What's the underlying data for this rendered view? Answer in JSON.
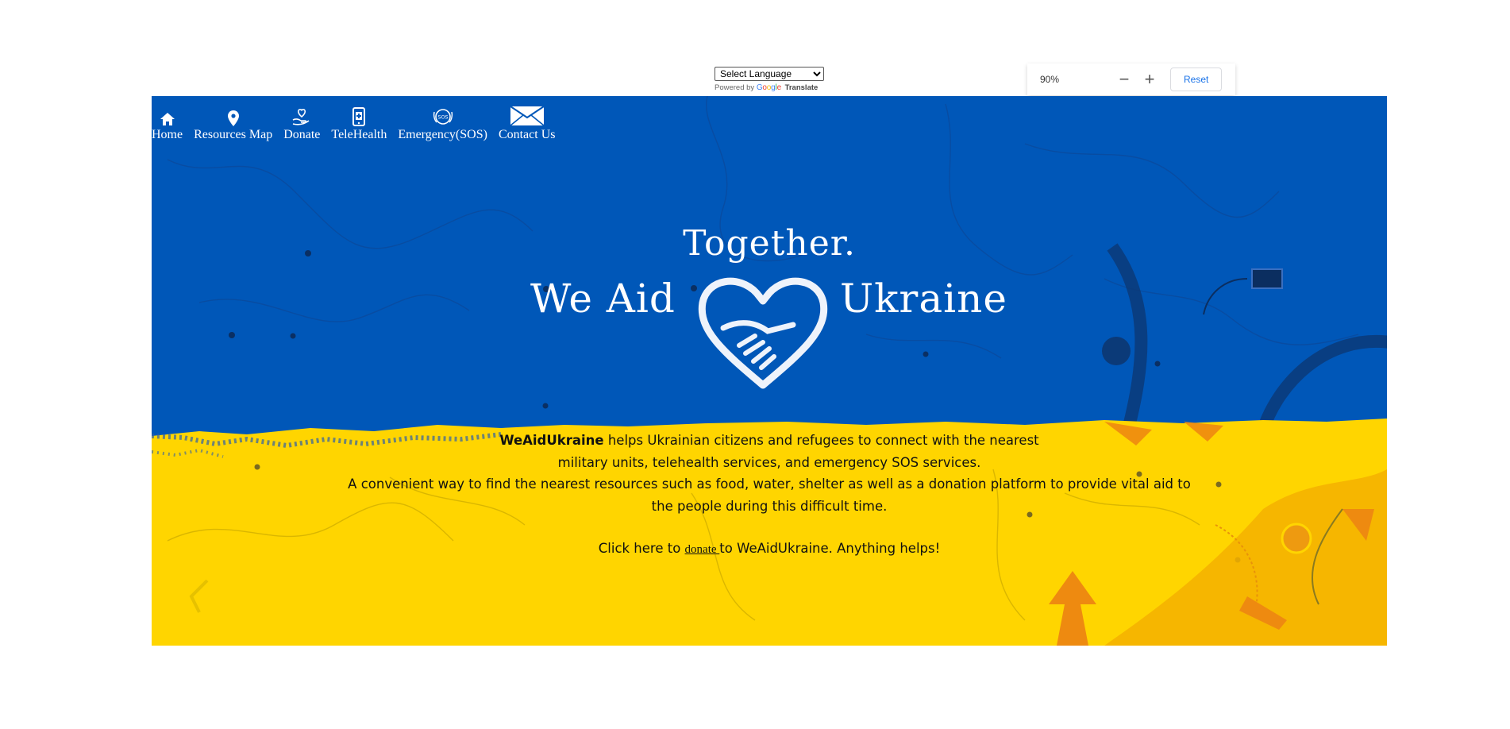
{
  "translate": {
    "select_value": "Select Language",
    "powered_by": "Powered by",
    "google_logo": [
      "G",
      "o",
      "o",
      "g",
      "l",
      "e"
    ],
    "translate_label": "Translate"
  },
  "zoom": {
    "level": "90%",
    "minus": "−",
    "plus": "+",
    "reset": "Reset"
  },
  "nav": {
    "items": [
      {
        "label": "Home",
        "icon": "home-icon"
      },
      {
        "label": "Resources Map",
        "icon": "map-pin-icon"
      },
      {
        "label": "Donate",
        "icon": "donate-heart-hand-icon"
      },
      {
        "label": "TeleHealth",
        "icon": "phone-medical-icon"
      },
      {
        "label": "Emergency(SOS)",
        "icon": "sos-icon"
      },
      {
        "label": "Contact Us",
        "icon": "envelope-icon"
      }
    ]
  },
  "hero": {
    "together": "Together.",
    "we_aid": "We Aid",
    "ukraine": "Ukraine",
    "desc_brand": "WeAidUkraine",
    "desc_line1_rest": " helps Ukrainian citizens and refugees to connect with the nearest",
    "desc_line2": "military units, telehealth services, and emergency SOS services.",
    "desc_line3": "A convenient way to find the nearest resources such as food, water, shelter as well as a donation platform to provide vital aid to",
    "desc_line4": "the people during this difficult time.",
    "cta_prefix": "Click here to ",
    "cta_link": "donate ",
    "cta_suffix": "to WeAidUkraine. Anything helps!"
  },
  "colors": {
    "flag_blue": "#0057b8",
    "flag_yellow": "#ffd500",
    "text_dark": "#111111",
    "link_blue": "#1a73e8"
  }
}
